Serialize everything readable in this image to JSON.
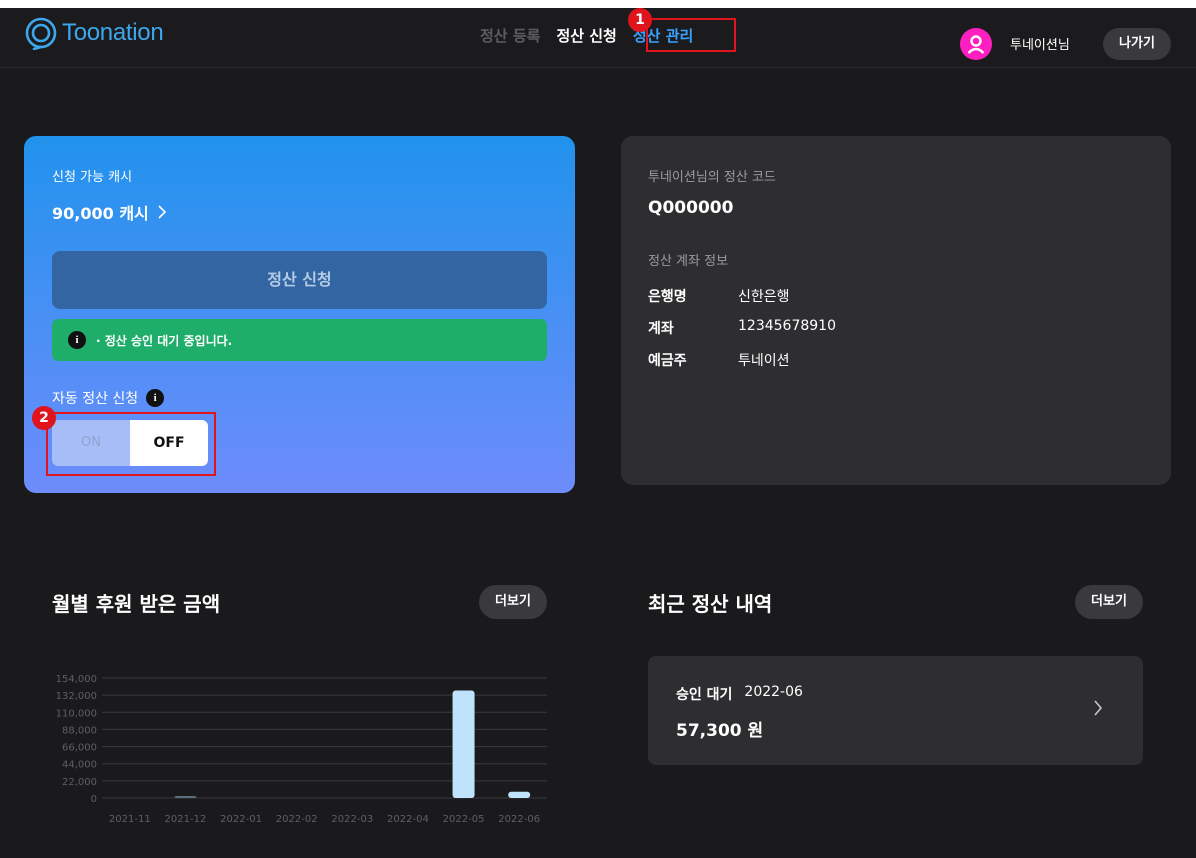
{
  "header": {
    "logo_text": "Toonation",
    "nav": [
      {
        "label": "정산 등록"
      },
      {
        "label": "정산 신청"
      },
      {
        "label": "정산 관리"
      }
    ],
    "badge1": "1",
    "user_name": "투네이션님",
    "exit_label": "나가기"
  },
  "cash_card": {
    "label": "신청 가능 캐시",
    "amount": "90,000 캐시",
    "apply_button": "정산 신청",
    "notice": "· 정산 승인 대기 중입니다.",
    "auto_label": "자동 정산 신청",
    "toggle_on": "ON",
    "toggle_off": "OFF",
    "toggle_state": "OFF",
    "badge2": "2"
  },
  "account_card": {
    "title": "투네이션님의 정산 코드",
    "code": "Q000000",
    "sub_title": "정산 계좌 정보",
    "rows": [
      {
        "key": "은행명",
        "value": "신한은행"
      },
      {
        "key": "계좌",
        "value": "12345678910"
      },
      {
        "key": "예금주",
        "value": "투네이션"
      }
    ]
  },
  "monthly": {
    "title": "월별 후원 받은 금액",
    "more": "더보기"
  },
  "recent": {
    "title": "최근 정산 내역",
    "more": "더보기",
    "status": "승인 대기",
    "period": "2022-06",
    "amount": "57,300 원"
  },
  "chart_data": {
    "type": "bar",
    "categories": [
      "2021-11",
      "2021-12",
      "2022-01",
      "2022-02",
      "2022-03",
      "2022-04",
      "2022-05",
      "2022-06"
    ],
    "values": [
      0,
      2000,
      0,
      0,
      0,
      0,
      138000,
      8000
    ],
    "y_ticks": [
      "0",
      "22,000",
      "44,000",
      "66,000",
      "88,000",
      "110,000",
      "132,000",
      "154,000"
    ],
    "ylim": [
      0,
      154000
    ],
    "colors": {
      "bar": "#bfe3fb",
      "bar_small": "#5a6e7c",
      "grid": "#3a3a3e"
    }
  },
  "colors": {
    "accent_blue": "#3aa2ff",
    "highlight_red": "#e0141d",
    "notice_green": "#1fae6a"
  }
}
